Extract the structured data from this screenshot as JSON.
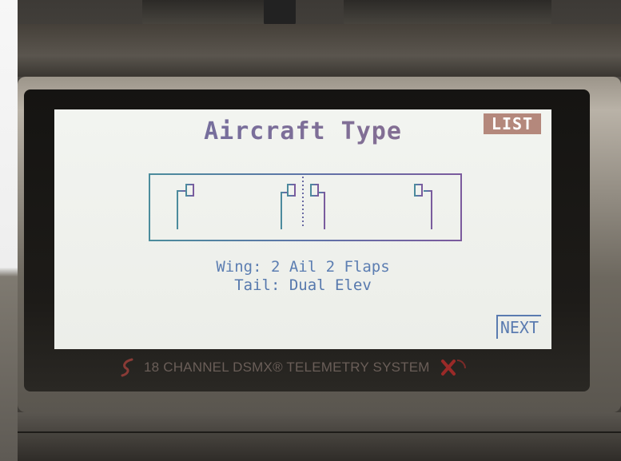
{
  "screen": {
    "title": "Aircraft Type",
    "list_label": "LIST",
    "wing_label": "Wing: 2 Ail 2 Flaps",
    "tail_label": "Tail: Dual Elev",
    "next_label": "NEXT"
  },
  "device": {
    "brand_text": "18 CHANNEL DSMX® TELEMETRY SYSTEM"
  },
  "icons": {
    "brand_logo": "spektrum-logo-icon",
    "brand_right": "x-logo-icon",
    "wing_diagram": "wing-servo-diagram-icon"
  },
  "colors": {
    "lcd_background": "#eef0ec",
    "title": "#766f9e",
    "list_button_bg": "#b4887c",
    "text_blue": "#5c7eb2",
    "diagram_teal": "#4b8c9c",
    "diagram_purple": "#7b5a9d"
  }
}
